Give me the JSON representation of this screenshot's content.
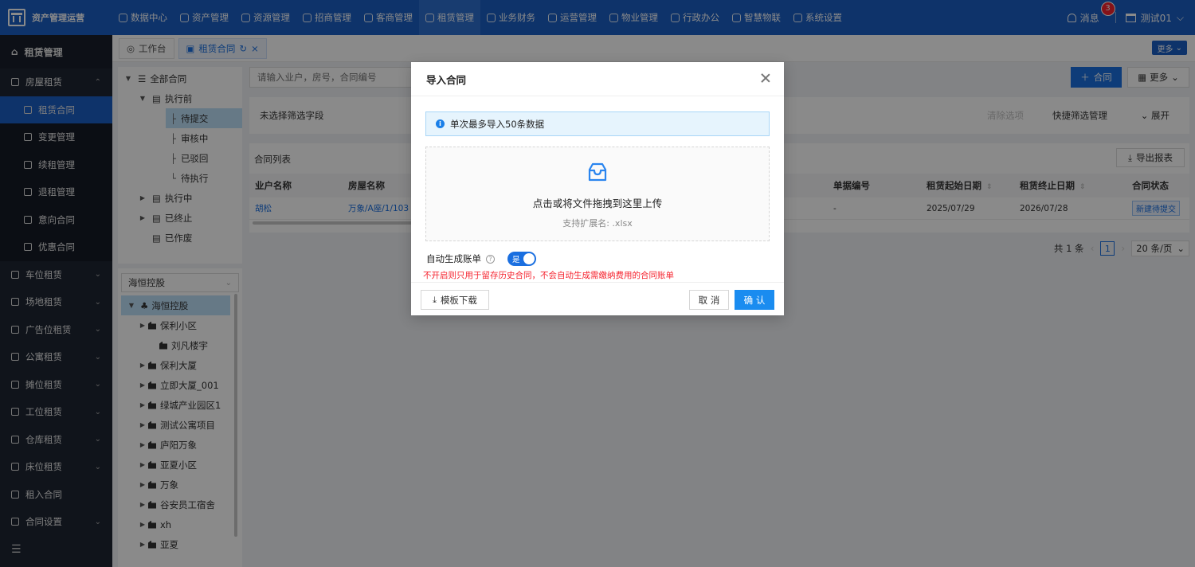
{
  "app": {
    "title": "资产管理运营"
  },
  "topnav": [
    {
      "label": "数据中心"
    },
    {
      "label": "资产管理"
    },
    {
      "label": "资源管理"
    },
    {
      "label": "招商管理"
    },
    {
      "label": "客商管理"
    },
    {
      "label": "租赁管理"
    },
    {
      "label": "业务财务"
    },
    {
      "label": "运营管理"
    },
    {
      "label": "物业管理"
    },
    {
      "label": "行政办公"
    },
    {
      "label": "智慧物联"
    },
    {
      "label": "系统设置"
    }
  ],
  "header": {
    "messages_label": "消息",
    "messages_count": "3",
    "user_name": "测试01"
  },
  "sidebar": {
    "title": "租赁管理",
    "group_open": "房屋租赁",
    "sub_items": [
      {
        "label": "租赁合同"
      },
      {
        "label": "变更管理"
      },
      {
        "label": "续租管理"
      },
      {
        "label": "退租管理"
      },
      {
        "label": "意向合同"
      },
      {
        "label": "优惠合同"
      }
    ],
    "groups": [
      {
        "label": "车位租赁"
      },
      {
        "label": "场地租赁"
      },
      {
        "label": "广告位租赁"
      },
      {
        "label": "公寓租赁"
      },
      {
        "label": "摊位租赁"
      },
      {
        "label": "工位租赁"
      },
      {
        "label": "仓库租赁"
      },
      {
        "label": "床位租赁"
      },
      {
        "label": "租入合同"
      },
      {
        "label": "合同设置"
      }
    ]
  },
  "tabs": [
    {
      "label": "工作台"
    },
    {
      "label": "租赁合同"
    }
  ],
  "tabs_more": "更多",
  "contract_tree": {
    "root": "全部合同",
    "before": "执行前",
    "before_children": [
      "待提交",
      "审核中",
      "已驳回",
      "待执行"
    ],
    "running": "执行中",
    "ended": "已终止",
    "voided": "已作废"
  },
  "org": {
    "selected": "海恒控股",
    "root": "海恒控股",
    "children": [
      "保利小区",
      "刘凡楼宇",
      "保利大厦",
      "立即大厦_001",
      "绿城产业园区1",
      "测试公寓项目",
      "庐阳万象",
      "亚夏小区",
      "万象",
      "谷安员工宿舍",
      "xh",
      "亚夏"
    ]
  },
  "toolbar": {
    "search_placeholder": "请输入业户，房号，合同编号",
    "add_label": "合同",
    "more_label": "更多"
  },
  "filter": {
    "none_selected": "未选择筛选字段",
    "clear": "清除选项",
    "quick_mgmt": "快捷筛选管理",
    "expand": "展开"
  },
  "list": {
    "title": "合同列表",
    "export": "导出报表",
    "columns": {
      "tenant": "业户名称",
      "house": "房屋名称",
      "doc_no": "单据编号",
      "start": "租赁起始日期",
      "end": "租赁终止日期",
      "status": "合同状态"
    },
    "rows": [
      {
        "tenant": "胡松",
        "house": "万象/A座/1/103",
        "doc_no": "-",
        "start": "2025/07/29",
        "end": "2026/07/28",
        "status": "新建待提交"
      }
    ]
  },
  "pager": {
    "total": "共 1 条",
    "page": "1",
    "size": "20 条/页"
  },
  "modal": {
    "title": "导入合同",
    "notice": "单次最多导入50条数据",
    "upload_text": "点击或将文件拖拽到这里上传",
    "upload_hint": "支持扩展名: .xlsx",
    "autogen_label": "自动生成账单",
    "toggle_on": "是",
    "warning": "不开启则只用于留存历史合同，不会自动生成需缴纳费用的合同账单",
    "template_btn": "模板下载",
    "cancel": "取 消",
    "confirm": "确 认"
  },
  "colors": {
    "primary": "#1a5ec4",
    "accent": "#1a6fe0",
    "sidebar": "#1e2533",
    "danger": "#f5222d"
  }
}
